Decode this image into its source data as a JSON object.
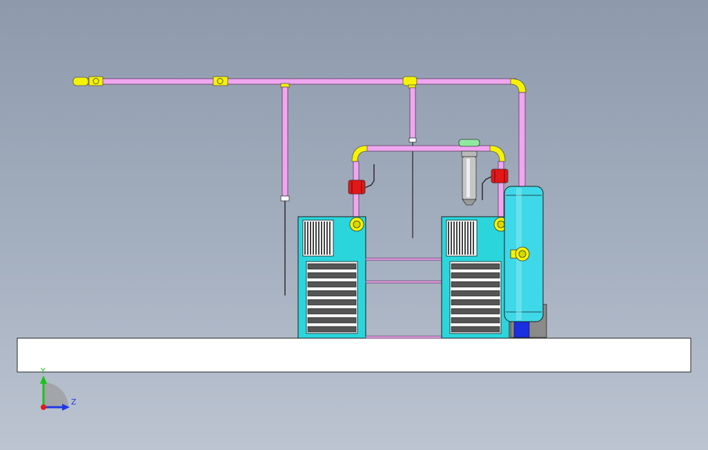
{
  "triad": {
    "y_label": "Y",
    "z_label": "Z"
  },
  "colors": {
    "background_top": "#8e9aac",
    "background_bottom": "#bcc4d1",
    "pipe": "#f0a6f0",
    "fitting": "#f5f300",
    "valve": "#e01818",
    "equipment_body": "#2ad6dc",
    "tank": "#3fd8e8",
    "filter_body": "#b8b8b8",
    "filter_cap": "#8fe8a0",
    "base_block": "#1a30e0",
    "floor_slab": "#ffffff",
    "axis_y": "#19c319",
    "axis_z": "#1f37e6",
    "axis_x": "#e01a1a"
  },
  "components": [
    {
      "name": "main-header-pipe",
      "type": "pipe"
    },
    {
      "name": "drop-pipe-left",
      "type": "pipe"
    },
    {
      "name": "drop-pipe-middle",
      "type": "pipe"
    },
    {
      "name": "riser-pipe-right",
      "type": "pipe"
    },
    {
      "name": "air-compressor-left",
      "type": "compressor"
    },
    {
      "name": "air-compressor-right",
      "type": "compressor"
    },
    {
      "name": "ball-valve-left",
      "type": "valve"
    },
    {
      "name": "ball-valve-right",
      "type": "valve"
    },
    {
      "name": "inline-filter",
      "type": "filter"
    },
    {
      "name": "air-receiver-tank",
      "type": "tank"
    },
    {
      "name": "floor-slab",
      "type": "slab"
    }
  ]
}
